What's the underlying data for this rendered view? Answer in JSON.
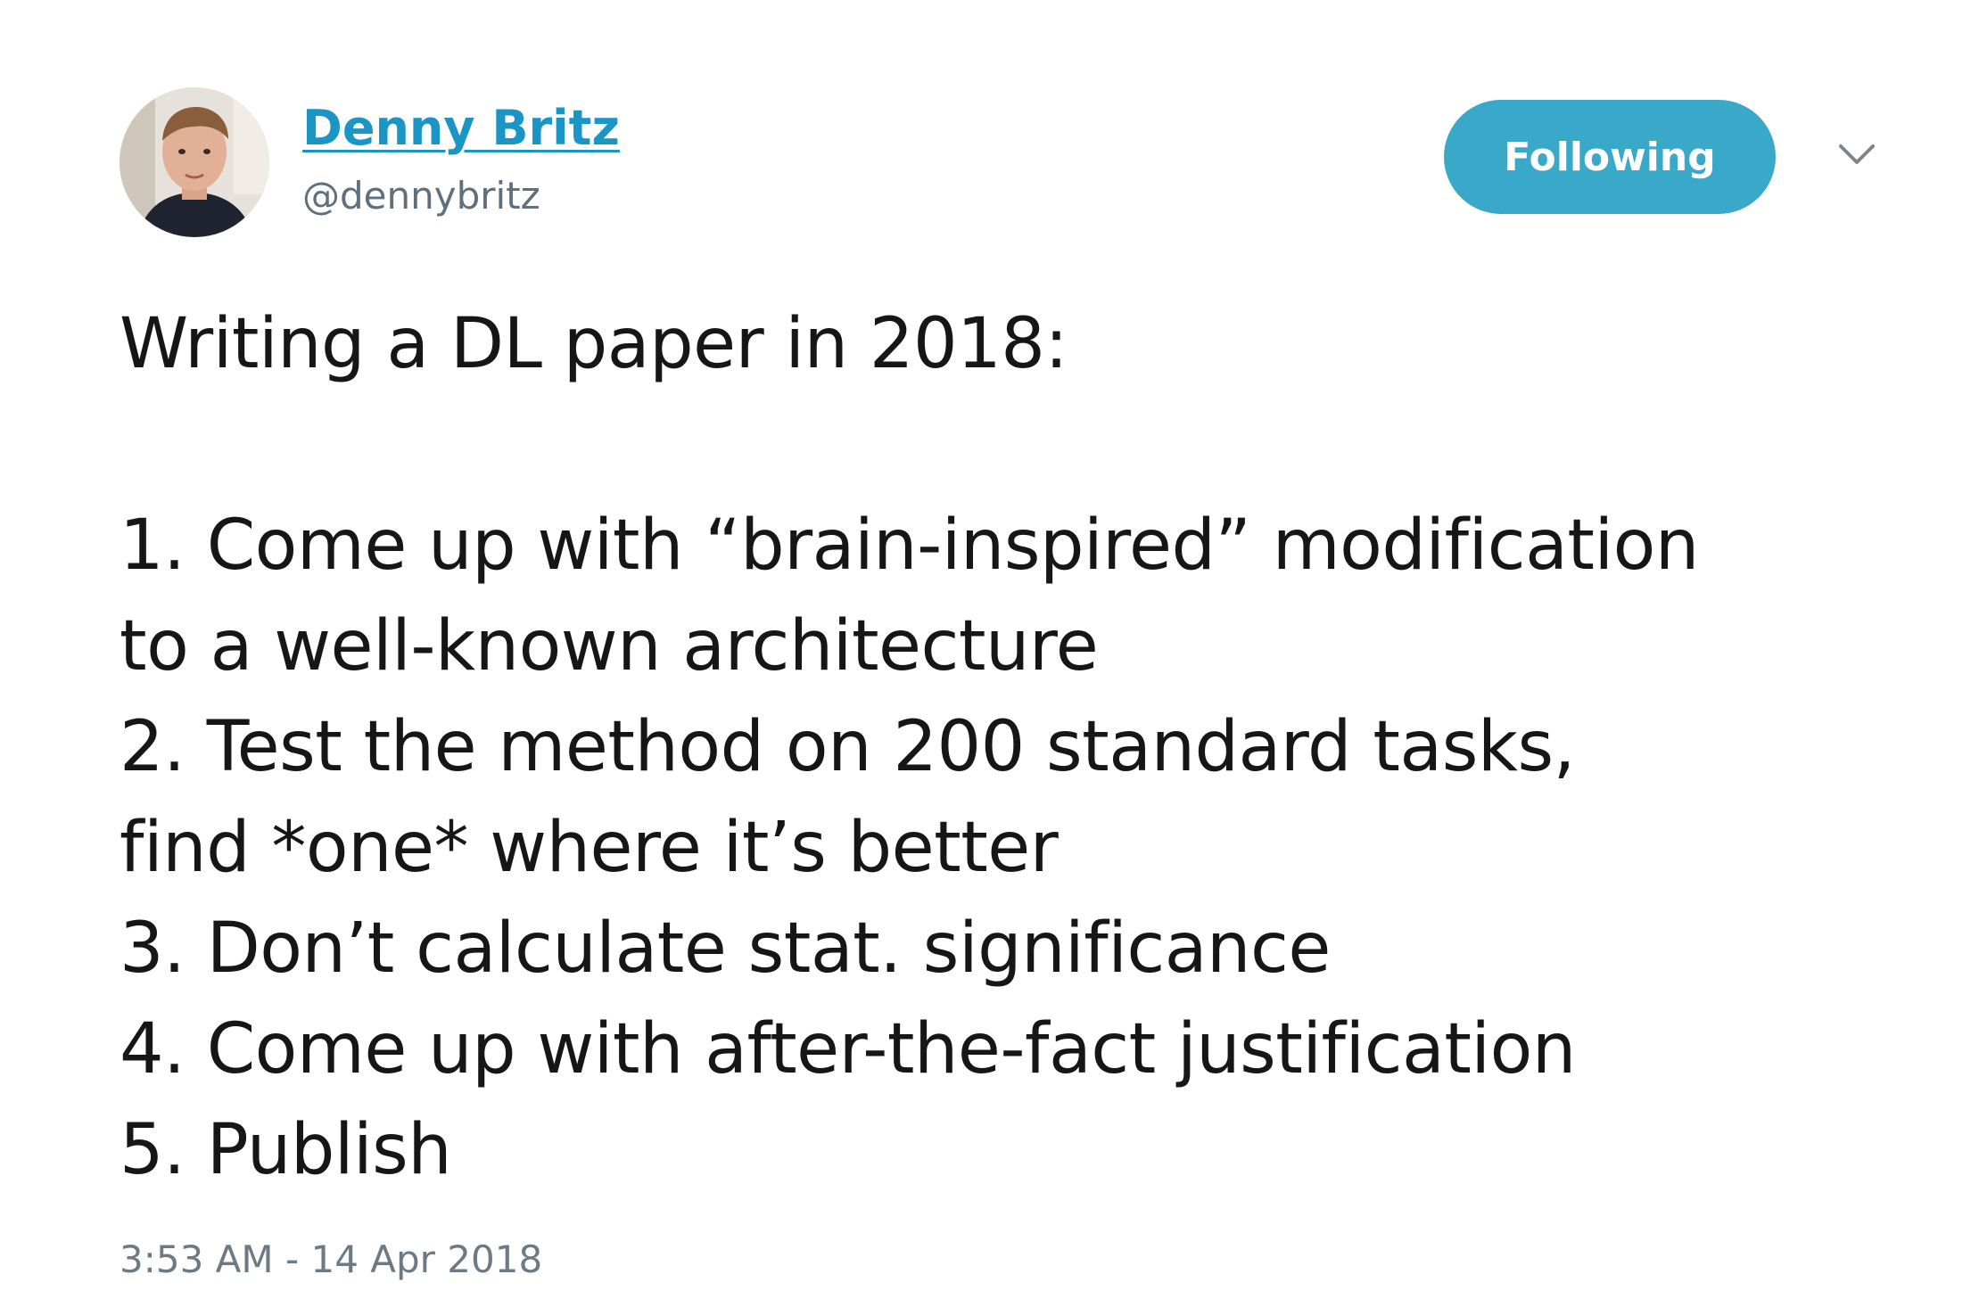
{
  "author": {
    "display_name": "Denny Britz",
    "handle": "@dennybritz"
  },
  "follow_button": {
    "label": "Following",
    "color": "#3aa8c9"
  },
  "menu": {
    "icon": "chevron-down-icon"
  },
  "tweet": {
    "lines": [
      "Writing a DL paper in 2018:",
      "",
      "1. Come up with “brain-inspired” modification",
      "to a well-known architecture",
      "2. Test the method on 200 standard tasks,",
      "find *one* where it’s better",
      "3. Don’t calculate stat. significance",
      "4. Come up with after-the-fact justification",
      "5. Publish"
    ],
    "timestamp": "3:53 AM - 14 Apr 2018"
  },
  "colors": {
    "link": "#1b95c4",
    "secondary_text": "#5f6f7d"
  }
}
